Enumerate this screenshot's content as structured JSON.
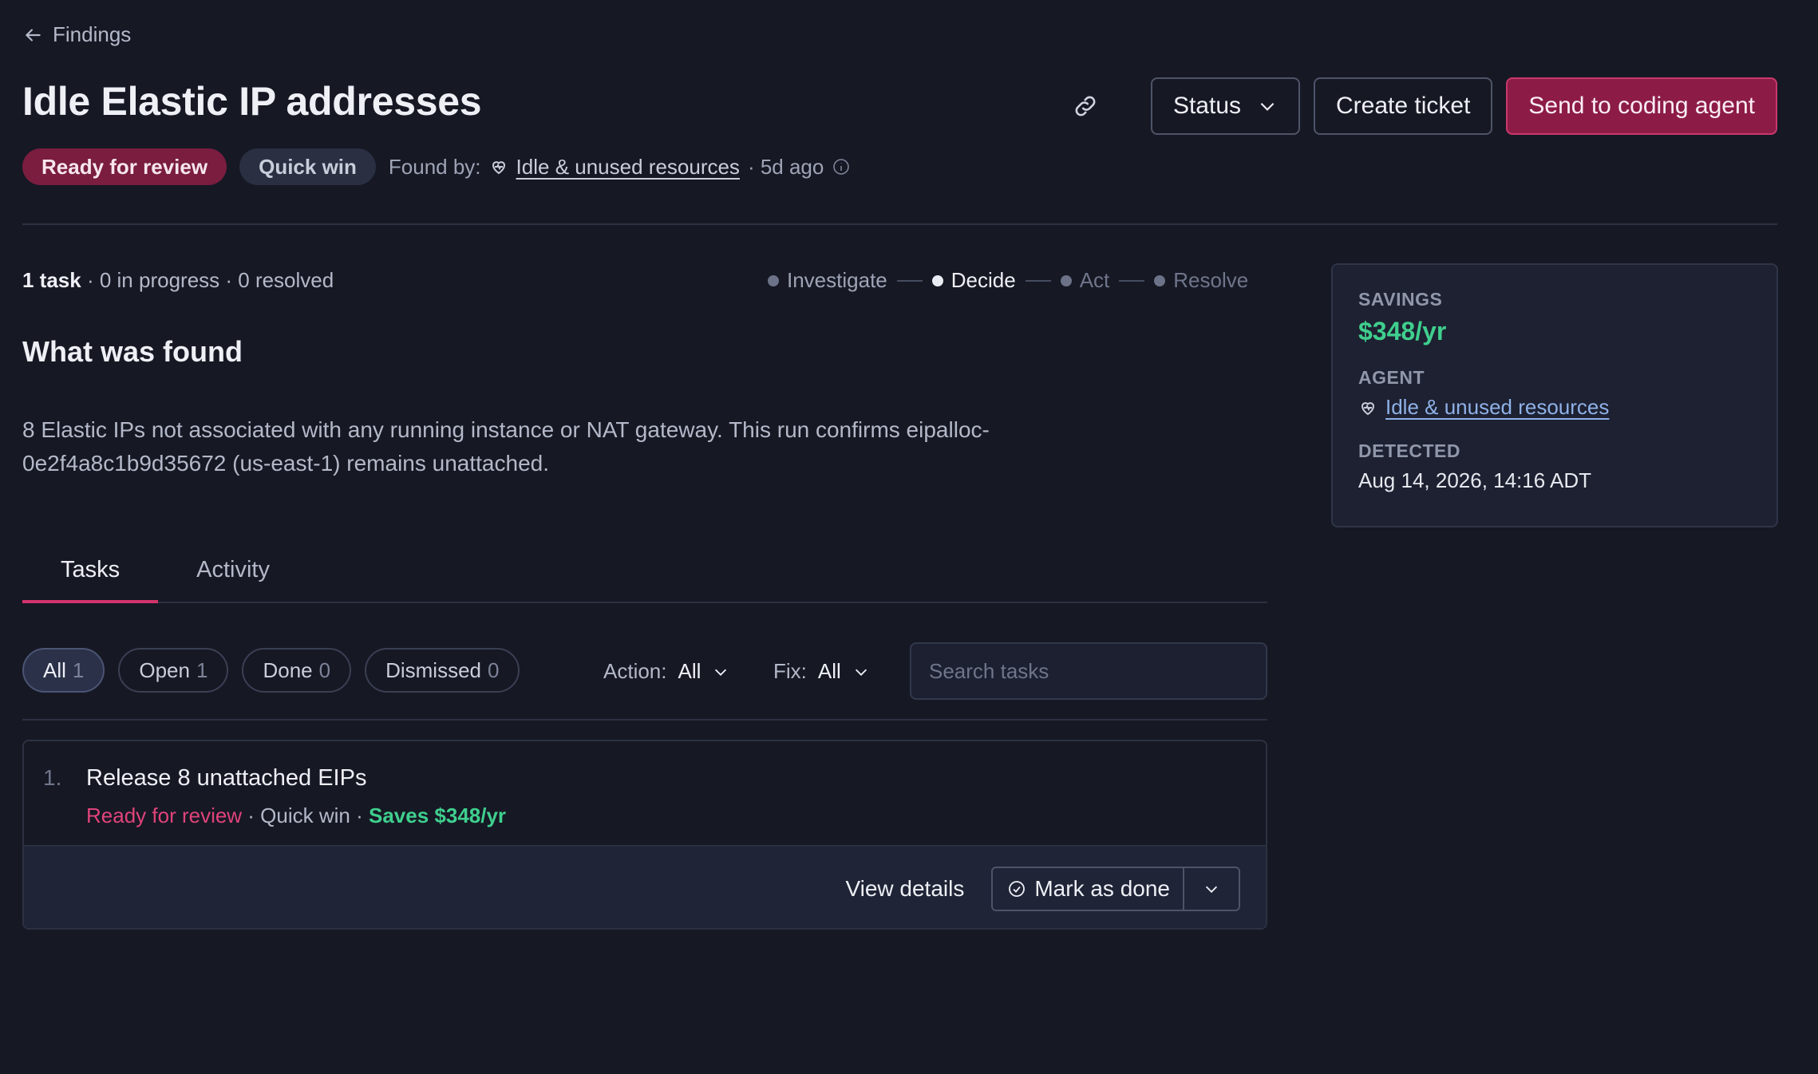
{
  "nav": {
    "back_label": "Findings"
  },
  "header": {
    "title": "Idle Elastic IP addresses",
    "status_label": "Status",
    "create_ticket_label": "Create ticket",
    "send_agent_label": "Send to coding agent"
  },
  "meta": {
    "status_pill": "Ready for review",
    "effort_pill": "Quick win",
    "found_by_label": "Found by:",
    "agent_name": "Idle & unused resources",
    "age": "· 5d ago"
  },
  "summary": {
    "task_count": "1 task",
    "progress_text": "· 0 in progress · 0 resolved"
  },
  "steps": [
    "Investigate",
    "Decide",
    "Act",
    "Resolve"
  ],
  "finding": {
    "heading": "What was found",
    "description": "8 Elastic IPs not associated with any running instance or NAT gateway. This run confirms eipalloc-0e2f4a8c1b9d35672 (us-east-1) remains unattached."
  },
  "tabs": [
    "Tasks",
    "Activity"
  ],
  "filters": {
    "chips": [
      {
        "label": "All",
        "count": "1"
      },
      {
        "label": "Open",
        "count": "1"
      },
      {
        "label": "Done",
        "count": "0"
      },
      {
        "label": "Dismissed",
        "count": "0"
      }
    ],
    "action_label": "Action:",
    "action_value": "All",
    "fix_label": "Fix:",
    "fix_value": "All",
    "search_placeholder": "Search tasks"
  },
  "task": {
    "number": "1.",
    "title": "Release 8 unattached EIPs",
    "status": "Ready for review",
    "effort": " · Quick win · ",
    "savings": "Saves $348/yr",
    "view_label": "View details",
    "done_label": "Mark as done"
  },
  "side": {
    "savings_label": "SAVINGS",
    "savings_value": "$348/yr",
    "agent_label": "AGENT",
    "agent_value": "Idle & unused resources",
    "detected_label": "DETECTED",
    "detected_value": "Aug 14, 2026, 14:16 ADT"
  },
  "colors": {
    "background": "#161824",
    "accent": "#d2346c",
    "savings_green": "#3fcf8e",
    "link_blue": "#8fb1e8"
  }
}
